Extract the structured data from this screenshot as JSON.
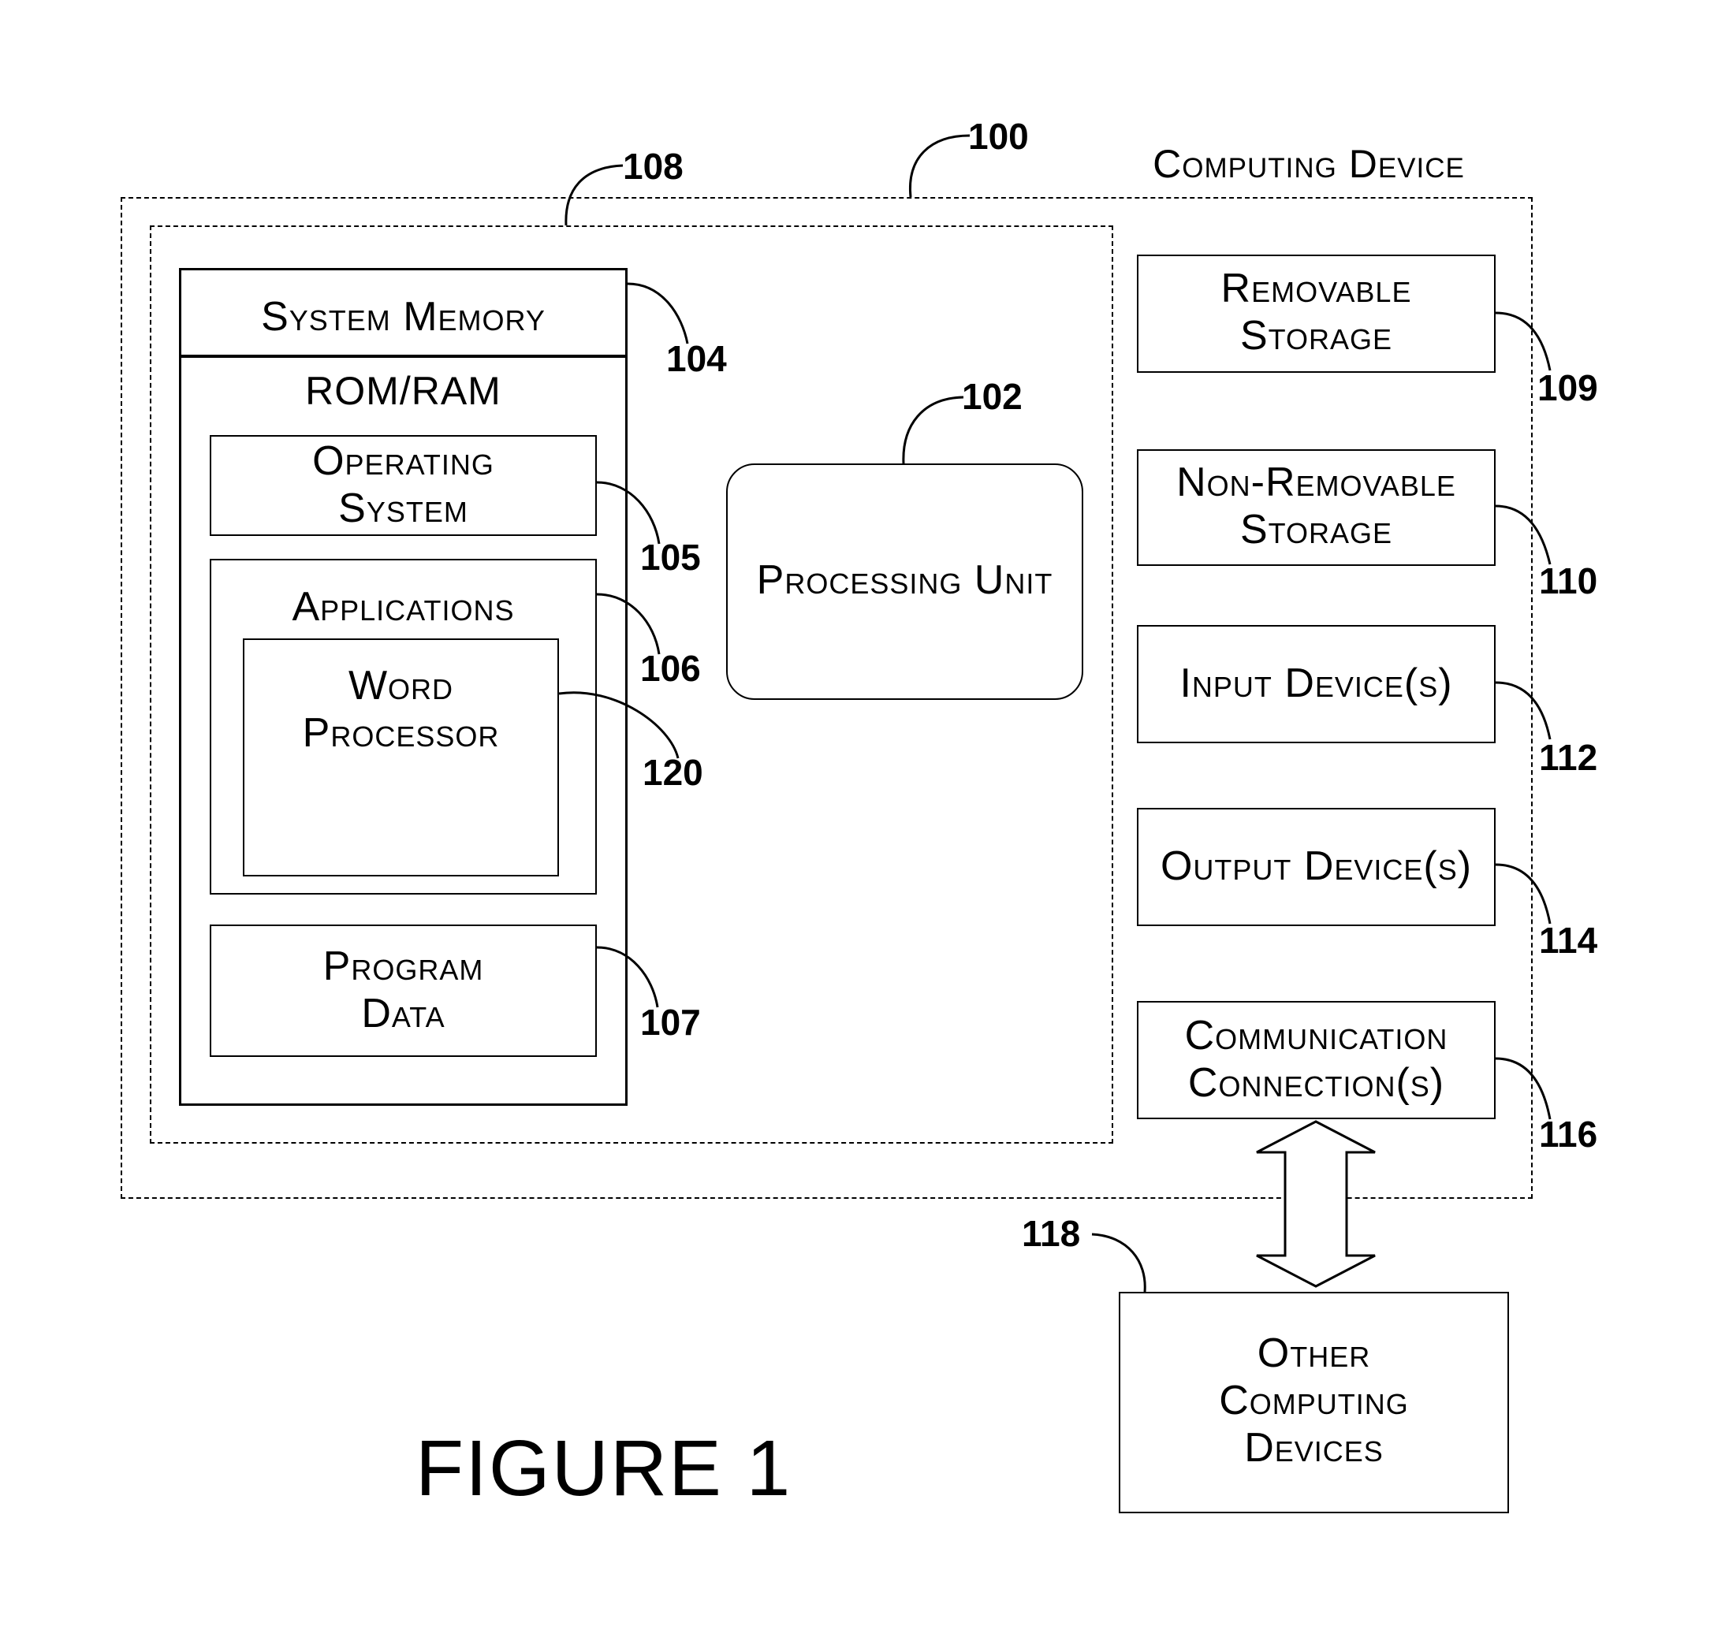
{
  "figure_label": "FIGURE 1",
  "computing_device": {
    "title": "Computing Device",
    "ref": "100"
  },
  "basic_config": {
    "ref": "108"
  },
  "system_memory": {
    "title": "System Memory",
    "ref": "104",
    "subtitle": "ROM/RAM"
  },
  "operating_system": {
    "line1": "Operating",
    "line2": "System",
    "ref": "105"
  },
  "applications": {
    "title": "Applications",
    "ref": "106"
  },
  "word_processor": {
    "line1": "Word",
    "line2": "Processor",
    "ref": "120"
  },
  "program_data": {
    "line1": "Program",
    "line2": "Data",
    "ref": "107"
  },
  "processing_unit": {
    "title": "Processing Unit",
    "ref": "102"
  },
  "removable_storage": {
    "line1": "Removable",
    "line2": "Storage",
    "ref": "109"
  },
  "non_removable_storage": {
    "line1": "Non-Removable",
    "line2": "Storage",
    "ref": "110"
  },
  "input_devices": {
    "title": "Input Device(s)",
    "ref": "112"
  },
  "output_devices": {
    "title": "Output Device(s)",
    "ref": "114"
  },
  "communication": {
    "line1": "Communication",
    "line2": "Connection(s)",
    "ref": "116"
  },
  "other_devices": {
    "line1": "Other",
    "line2": "Computing",
    "line3": "Devices",
    "ref": "118"
  }
}
